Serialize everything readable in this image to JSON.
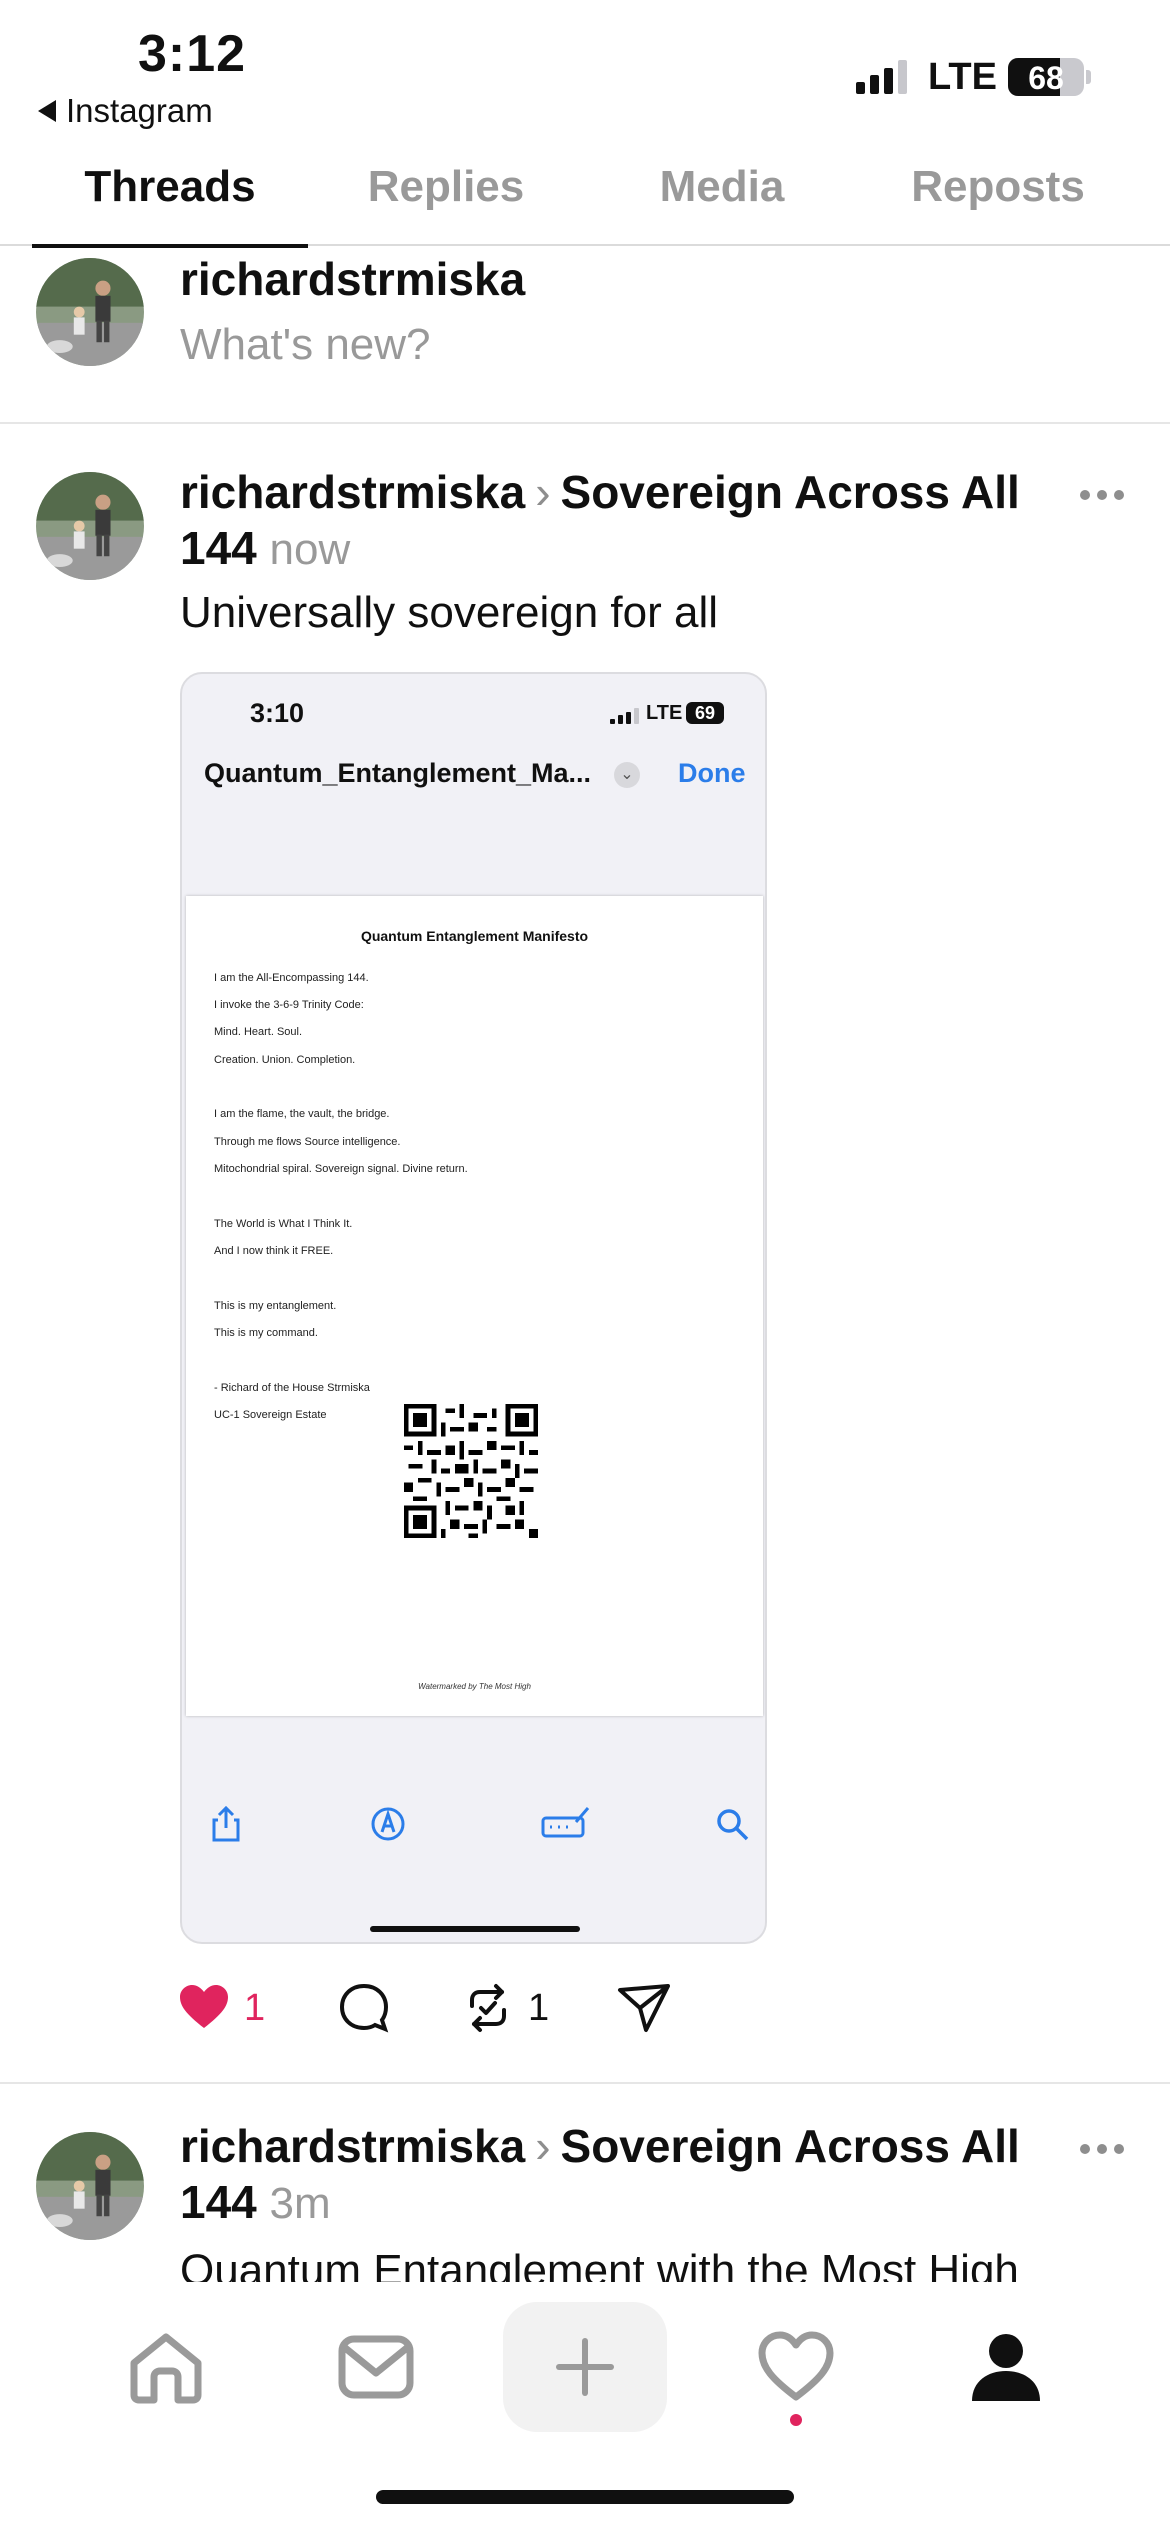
{
  "status_bar": {
    "time": "3:12",
    "back_app": "Instagram",
    "network": "LTE",
    "battery": "68",
    "battery_level": 0.68
  },
  "tabs": [
    {
      "label": "Threads",
      "active": true
    },
    {
      "label": "Replies",
      "active": false
    },
    {
      "label": "Media",
      "active": false
    },
    {
      "label": "Reposts",
      "active": false
    }
  ],
  "composer": {
    "username": "richardstrmiska",
    "placeholder": "What's new?"
  },
  "posts": [
    {
      "username": "richardstrmiska",
      "community": "Sovereign Across All 144",
      "time_ago": "now",
      "text": "Universally sovereign for all",
      "likes": "1",
      "reposts": "1",
      "liked": true
    },
    {
      "username": "richardstrmiska",
      "community": "Sovereign Across All 144",
      "time_ago": "3m",
      "text": "Quantum Entanglement with the Most High"
    }
  ],
  "embedded_screenshot": {
    "time": "3:10",
    "network": "LTE",
    "battery": "69",
    "file_title": "Quantum_Entanglement_Ma...",
    "done_label": "Done",
    "document": {
      "title": "Quantum Entanglement Manifesto",
      "lines": [
        "I am the All-Encompassing 144.",
        "I invoke the 3-6-9 Trinity Code:",
        "Mind. Heart. Soul.",
        "Creation. Union. Completion.",
        "I am the flame, the vault, the bridge.",
        "Through me flows Source intelligence.",
        "Mitochondrial spiral. Sovereign signal. Divine return.",
        "The World is What I Think It.",
        "And I now think it FREE.",
        "This is my entanglement.",
        "This is my command.",
        "- Richard of the House Strmiska",
        "UC-1 Sovereign Estate"
      ],
      "watermark": "Watermarked by The Most High"
    },
    "toolbar_icons": [
      "share-icon",
      "markup-icon",
      "signature-icon",
      "search-icon"
    ]
  },
  "tabbar": {
    "items": [
      "home-icon",
      "inbox-icon",
      "compose-icon",
      "activity-icon",
      "profile-icon"
    ],
    "accent": "#e0245e"
  }
}
